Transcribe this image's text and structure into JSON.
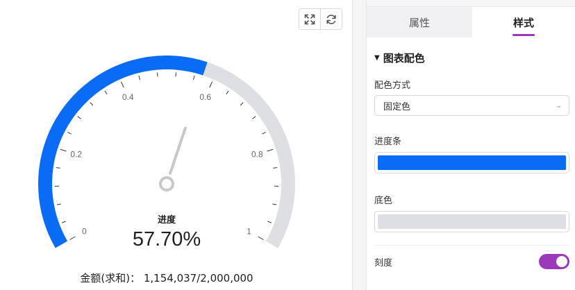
{
  "chart": {
    "center_label": "进度",
    "center_value": "57.70%",
    "amount_text": "金额(求和)： 1,154,037/2,000,000",
    "tick_labels": [
      "0",
      "0.2",
      "0.4",
      "0.6",
      "0.8",
      "1"
    ],
    "progress_color": "#0a6cf5",
    "track_color": "#dedfe2"
  },
  "chart_data": {
    "type": "gauge",
    "value": 0.577,
    "min": 0,
    "max": 1,
    "label": "进度",
    "display_value": "57.70%",
    "tick_labels": [
      "0",
      "0.2",
      "0.4",
      "0.6",
      "0.8",
      "1"
    ],
    "aggregate": {
      "label": "金额(求和)",
      "current": 1154037,
      "target": 2000000
    }
  },
  "toolbar": {
    "fullscreen_icon": "expand-icon",
    "refresh_icon": "refresh-icon"
  },
  "panel": {
    "tabs": [
      {
        "label": "属性",
        "active": false
      },
      {
        "label": "样式",
        "active": true
      }
    ],
    "section_title": "图表配色",
    "color_mode_label": "配色方式",
    "color_mode_value": "固定色",
    "progress_bar_label": "进度条",
    "progress_bar_color": "#0a6cf5",
    "base_color_label": "底色",
    "base_color": "#dedfe2",
    "scale_label": "刻度",
    "scale_enabled": true,
    "toggle_color": "#9b38b8",
    "accent_color": "#9b38b8"
  }
}
